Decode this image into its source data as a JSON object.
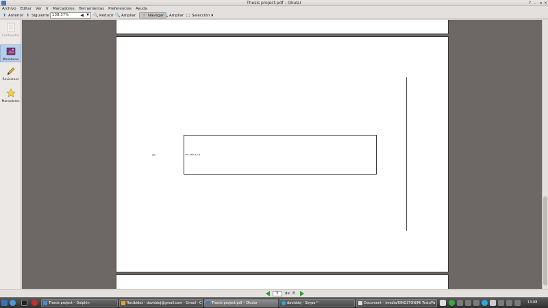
{
  "window": {
    "title": "Thesis project.pdf – Okular"
  },
  "menu": {
    "items": [
      "Archivo",
      "Editar",
      "Ver",
      "Ir",
      "Marcadores",
      "Herramientas",
      "Preferencias",
      "Ayuda"
    ]
  },
  "toolbar": {
    "prev_label": "Anterior",
    "next_label": "Siguiente",
    "zoom_value": "138,37%",
    "zoom_out_label": "Reducir",
    "zoom_in_label": "Ampliar",
    "browse_label": "Navegar",
    "magnify_label": "Ampliar",
    "select_label": "Selección"
  },
  "sidebar": {
    "items": [
      {
        "label": "Contenidos",
        "icon": "contents-icon",
        "disabled": true
      },
      {
        "label": "Miniaturas",
        "icon": "thumbnails-icon",
        "active": true
      },
      {
        "label": "Revisiones",
        "icon": "pencil-icon"
      },
      {
        "label": "Marcadores",
        "icon": "star-icon"
      }
    ]
  },
  "document": {
    "small_label": "dn",
    "box_label": "cre ekb e_Lq"
  },
  "pagenav": {
    "current_page": "5",
    "of_label": "de",
    "total_pages": "8"
  },
  "taskbar": {
    "tasks": [
      {
        "label": "Thesis project – Dolphin"
      },
      {
        "label": "Recibidos - daviddoj@gmail.com - Gmail - C"
      },
      {
        "label": "Thesis project.pdf – Okular",
        "active": true
      },
      {
        "label": "daviddoj - Skype™"
      },
      {
        "label": "Document - /media/KINGSTON/Mi Tesis/Pa"
      }
    ],
    "clock": "13:08"
  },
  "colors": {
    "doc_background": "#6d6865",
    "accent": "#4a78b8",
    "nav_arrow": "#2e9a2e"
  }
}
